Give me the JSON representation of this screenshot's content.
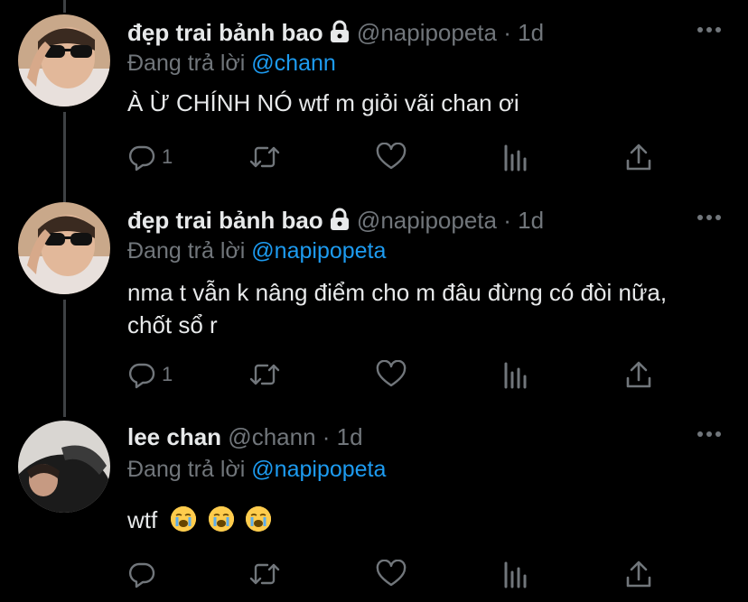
{
  "tweets": [
    {
      "name": "đẹp trai bảnh bao",
      "handle": "@napipopeta",
      "dot": "·",
      "time": "1d",
      "reply_prefix": "Đang trả lời",
      "reply_to": "@chann",
      "text": "À Ừ CHÍNH NÓ wtf m giỏi vãi chan ơi",
      "reply_count": "1",
      "locked": true
    },
    {
      "name": "đẹp trai bảnh bao",
      "handle": "@napipopeta",
      "dot": "·",
      "time": "1d",
      "reply_prefix": "Đang trả lời",
      "reply_to": "@napipopeta",
      "text": "nma t vẫn k nâng điểm cho m đâu đừng có đòi nữa, chốt sổ r",
      "reply_count": "1",
      "locked": true
    },
    {
      "name": "lee chan",
      "handle": "@chann",
      "dot": "·",
      "time": "1d",
      "reply_prefix": "Đang trả lời",
      "reply_to": "@napipopeta",
      "text": "wtf",
      "emojis": [
        "loudly-crying-face-icon",
        "loudly-crying-face-icon",
        "loudly-crying-face-icon"
      ],
      "reply_count": "",
      "locked": false
    }
  ],
  "colors": {
    "background": "#000000",
    "text": "#e7e9ea",
    "secondary": "#71767b",
    "accent": "#1d9bf0",
    "thread_line": "#3e4144"
  }
}
